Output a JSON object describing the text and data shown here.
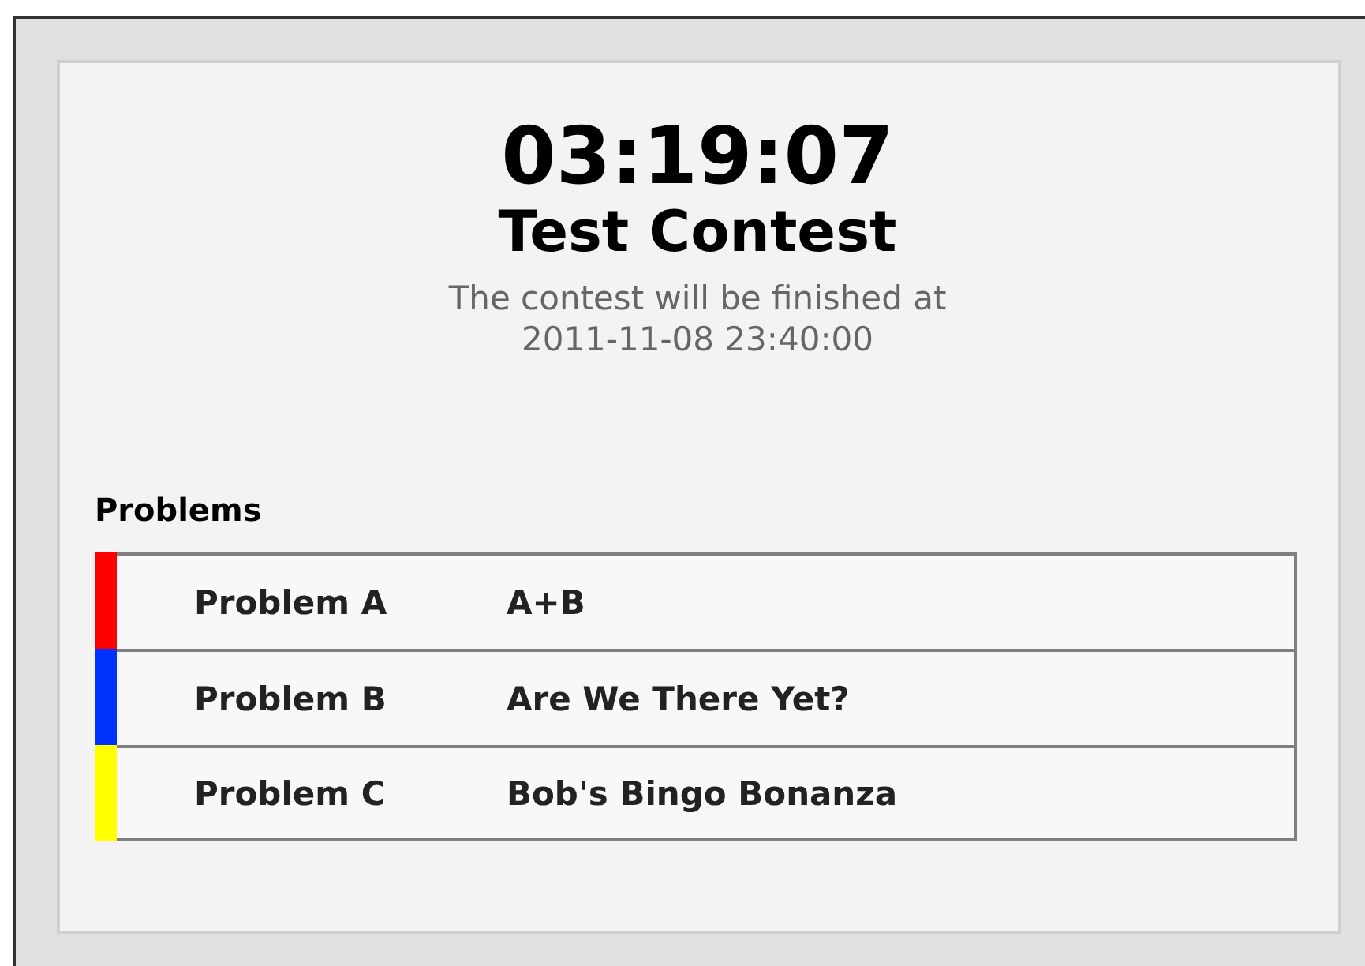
{
  "timer": "03:19:07",
  "contest": {
    "title": "Test Contest",
    "end_note": "The contest will be finished at",
    "end_time": "2011-11-08 23:40:00"
  },
  "problems": {
    "heading": "Problems",
    "items": [
      {
        "label": "Problem A",
        "name": "A+B",
        "color": "#ff0000"
      },
      {
        "label": "Problem B",
        "name": "Are We There Yet?",
        "color": "#0033ff"
      },
      {
        "label": "Problem C",
        "name": "Bob's Bingo Bonanza",
        "color": "#ffff00"
      }
    ]
  }
}
